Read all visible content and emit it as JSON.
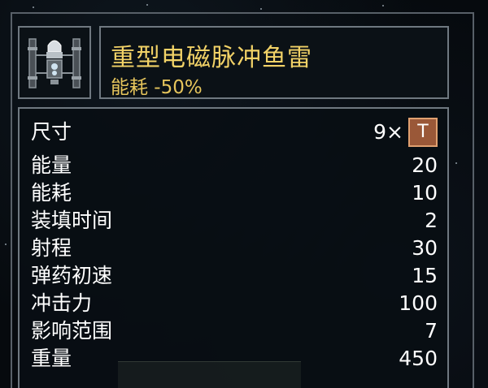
{
  "item": {
    "name": "重型电磁脉冲鱼雷",
    "subtitle": "能耗 -50%",
    "icon": "torpedo-launcher-icon"
  },
  "stats": {
    "size": {
      "label": "尺寸",
      "value": "9×",
      "badge": "T"
    },
    "rows": [
      {
        "label": "能量",
        "value": "20"
      },
      {
        "label": "能耗",
        "value": "10"
      },
      {
        "label": "装填时间",
        "value": "2"
      },
      {
        "label": "射程",
        "value": "30"
      },
      {
        "label": "弹药初速",
        "value": "15"
      },
      {
        "label": "冲击力",
        "value": "100"
      },
      {
        "label": "影响范围",
        "value": "7"
      },
      {
        "label": "重量",
        "value": "450"
      }
    ]
  },
  "colors": {
    "title": "#f2d267",
    "frame": "#6f7880",
    "badge_bg": "#9a5838",
    "badge_border": "#e0a070"
  }
}
